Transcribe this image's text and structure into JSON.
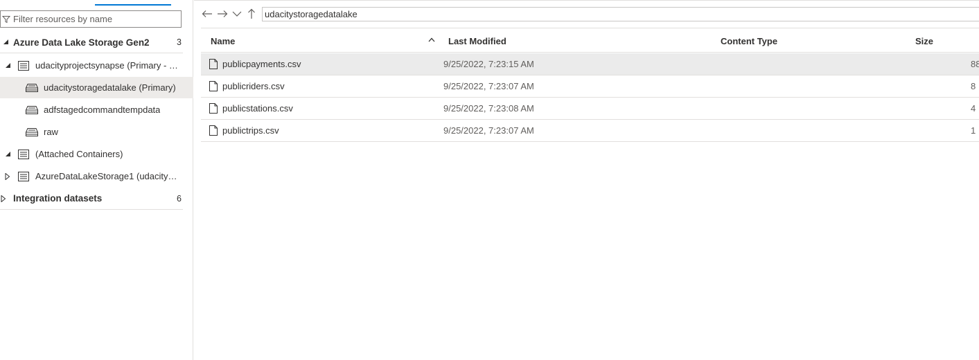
{
  "left": {
    "filter": {
      "placeholder": "Filter resources by name",
      "value": ""
    },
    "tree": {
      "adls_section": {
        "label": "Azure Data Lake Storage Gen2",
        "count": "3"
      },
      "workspace": {
        "label": "udacityprojectsynapse (Primary - u..."
      },
      "containers": [
        {
          "label": "udacitystoragedatalake (Primary)"
        },
        {
          "label": "adfstagedcommandtempdata"
        },
        {
          "label": "raw"
        }
      ],
      "attached": {
        "label": "(Attached Containers)"
      },
      "adls1": {
        "label": "AzureDataLakeStorage1 (udacityst..."
      },
      "datasets_section": {
        "label": "Integration datasets",
        "count": "6"
      }
    }
  },
  "toolbar": {
    "path": "udacitystoragedatalake",
    "icons": [
      "back-arrow-icon",
      "forward-arrow-icon",
      "chevron-down-icon",
      "up-arrow-icon"
    ]
  },
  "grid": {
    "columns": {
      "name": "Name",
      "modified": "Last Modified",
      "type": "Content Type",
      "size": "Size"
    },
    "rows": [
      {
        "name": "publicpayments.csv",
        "modified": "9/25/2022, 7:23:15 AM",
        "type": "",
        "size": "88"
      },
      {
        "name": "publicriders.csv",
        "modified": "9/25/2022, 7:23:07 AM",
        "type": "",
        "size": "8"
      },
      {
        "name": "publicstations.csv",
        "modified": "9/25/2022, 7:23:08 AM",
        "type": "",
        "size": "4"
      },
      {
        "name": "publictrips.csv",
        "modified": "9/25/2022, 7:23:07 AM",
        "type": "",
        "size": "1"
      }
    ]
  },
  "colors": {
    "accent": "#0078d4",
    "selected_row": "#ebebeb",
    "selected_tree": "#edebe9",
    "border": "#e1dfdd"
  }
}
